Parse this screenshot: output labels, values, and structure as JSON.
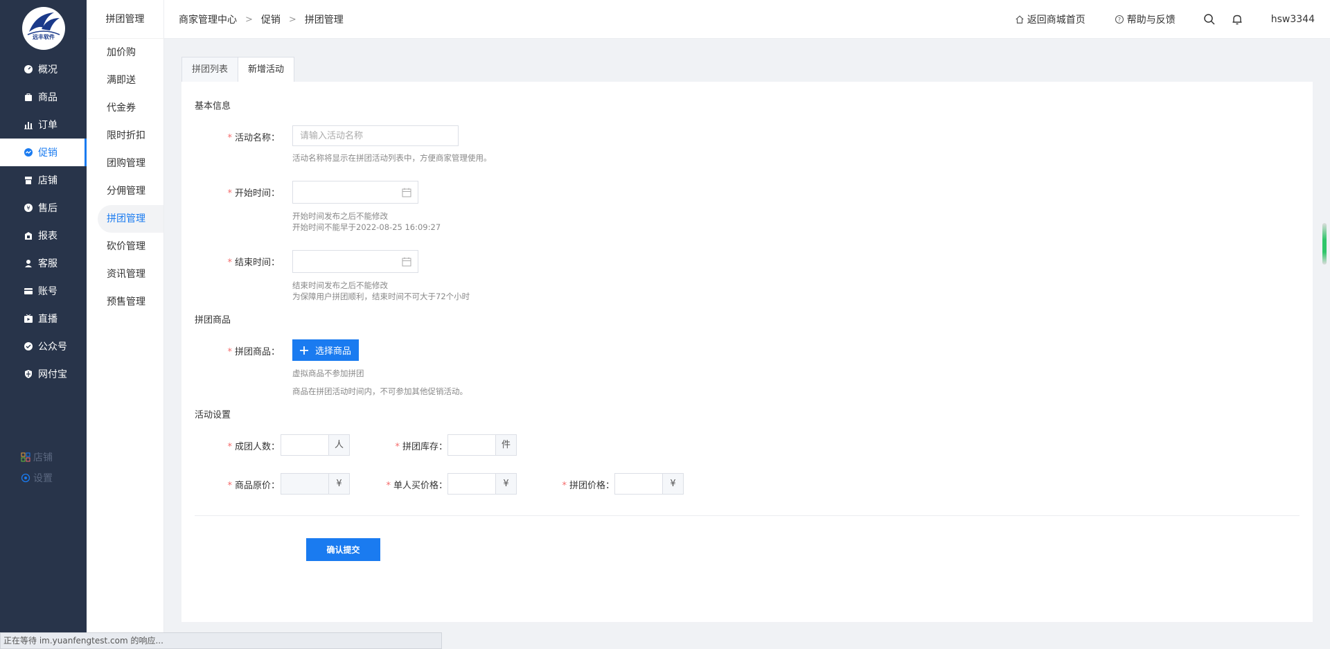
{
  "logo": {
    "text": "远丰软件"
  },
  "sidebar": {
    "items": [
      {
        "label": "概况",
        "icon": "dashboard-icon"
      },
      {
        "label": "商品",
        "icon": "bag-icon"
      },
      {
        "label": "订单",
        "icon": "bar-chart-icon"
      },
      {
        "label": "促销",
        "icon": "promotion-icon"
      },
      {
        "label": "店铺",
        "icon": "store-icon"
      },
      {
        "label": "售后",
        "icon": "after-sale-icon"
      },
      {
        "label": "报表",
        "icon": "report-icon"
      },
      {
        "label": "客服",
        "icon": "service-icon"
      },
      {
        "label": "账号",
        "icon": "card-icon"
      },
      {
        "label": "直播",
        "icon": "live-icon"
      },
      {
        "label": "公众号",
        "icon": "badge-check-icon"
      },
      {
        "label": "网付宝",
        "icon": "shield-icon"
      }
    ],
    "active_index": 3,
    "footer": [
      {
        "label": "店铺",
        "icon": "grid-icon"
      },
      {
        "label": "设置",
        "icon": "settings-icon"
      }
    ]
  },
  "submenu": {
    "title": "拼团管理",
    "items": [
      "加价购",
      "满即送",
      "代金券",
      "限时折扣",
      "团购管理",
      "分佣管理",
      "拼团管理",
      "砍价管理",
      "资讯管理",
      "预售管理"
    ],
    "active_index": 6
  },
  "header": {
    "breadcrumb": [
      "商家管理中心",
      "促销",
      "拼团管理"
    ],
    "home_link": "返回商城首页",
    "help_link": "帮助与反馈",
    "username": "hsw3344"
  },
  "tabs": [
    "拼团列表",
    "新增活动"
  ],
  "active_tab": 1,
  "form": {
    "section_basic": "基本信息",
    "name_label": "活动名称：",
    "name_placeholder": "请输入活动名称",
    "name_hint": "活动名称将显示在拼团活动列表中，方便商家管理使用。",
    "start_label": "开始时间：",
    "start_hint_1": "开始时间发布之后不能修改",
    "start_hint_2": "开始时间不能早于2022-08-25 16:09:27",
    "end_label": "结束时间：",
    "end_hint_1": "结束时间发布之后不能修改",
    "end_hint_2": "为保障用户拼团顺利，结束时间不可大于72个小时",
    "section_goods": "拼团商品",
    "goods_label": "拼团商品：",
    "goods_button": "选择商品",
    "goods_hint_1": "虚拟商品不参加拼团",
    "goods_hint_2": "商品在拼团活动时间内，不可参加其他促销活动。",
    "section_settings": "活动设置",
    "group_size_label": "成团人数：",
    "group_size_unit": "人",
    "stock_label": "拼团库存：",
    "stock_unit": "件",
    "orig_price_label": "商品原价：",
    "single_price_label": "单人买价格：",
    "group_price_label": "拼团价格：",
    "currency": "¥",
    "submit": "确认提交"
  },
  "status_bar": "正在等待 im.yuanfengtest.com 的响应..."
}
